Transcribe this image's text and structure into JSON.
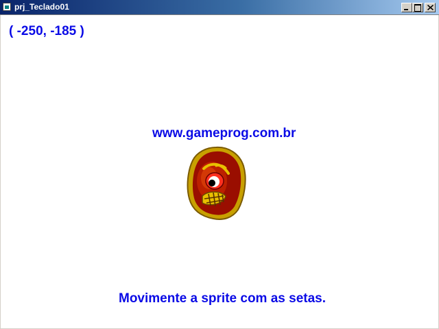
{
  "window": {
    "title": "prj_Teclado01",
    "icon": "app-window-icon",
    "controls": {
      "minimize_icon": "minimize-icon",
      "maximize_icon": "maximize-icon",
      "close_icon": "close-icon"
    }
  },
  "game": {
    "coordinates": "( -250, -185 )",
    "url_text": "www.gameprog.com.br",
    "instructions": "Movimente a sprite com as setas.",
    "sprite_icon": "monster-face-icon"
  },
  "colors": {
    "text": "#0a0ae6",
    "background": "#ffffff",
    "titlebar_start": "#0a246a",
    "titlebar_end": "#a6caf0",
    "sprite_outline": "#c8a000",
    "sprite_body": "#b01000"
  }
}
